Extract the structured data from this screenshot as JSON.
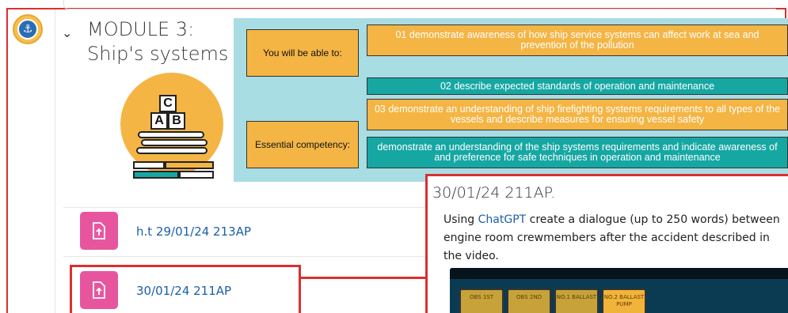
{
  "module": {
    "chevron": "⌄",
    "title_line1": "MODULE 3:",
    "title_line2": "Ship's systems"
  },
  "illustration": {
    "blocks": [
      "C",
      "A",
      "B"
    ]
  },
  "panel": {
    "label_able": "You will be able to:",
    "label_competency": "Essential competency:",
    "objectives": [
      "01 demonstrate awareness of how ship service systems can affect work at sea and prevention of the pollution",
      "02 describe expected standards of operation and maintenance",
      "03 demonstrate an understanding of ship firefighting systems requirements to all types of the vessels and describe measures for ensuring vessel safety"
    ],
    "competency": "demonstrate an understanding of the ship systems requirements and indicate awareness of and preference for safe techniques in operation and maintenance"
  },
  "activities": [
    {
      "label": "h.t 29/01/24 213AP",
      "icon": "file-upload-icon"
    },
    {
      "label": "30/01/24 211AP",
      "icon": "file-upload-icon"
    }
  ],
  "popup": {
    "title": "30/01/24 211AP.",
    "text_before": "Using ",
    "link": "ChatGPT",
    "text_after": " create a dialogue (up to 250 words) between engine room crewmembers after the accident described in the video.",
    "video_knobs": [
      "OBS 1ST",
      "OBS 2ND",
      "NO.1 BALLAST",
      "NO.2 BALLAST PUMP"
    ]
  },
  "colors": {
    "accent_red": "#d9302f",
    "orange": "#f4b545",
    "teal": "#16a7a3",
    "panel_bg": "#a9dde4",
    "activity_pink": "#e7559f",
    "link_blue": "#1b5fa8"
  }
}
